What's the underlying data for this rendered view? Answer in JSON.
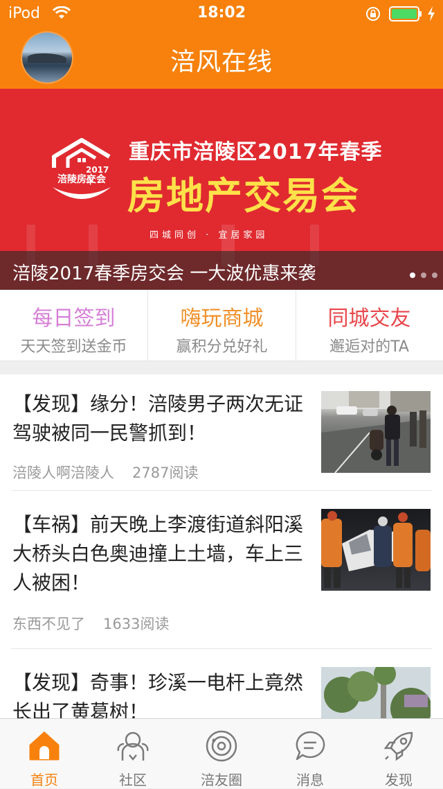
{
  "status_bar": {
    "carrier": "iPod",
    "time": "18:02",
    "battery_color": "#4cd964"
  },
  "nav": {
    "title": "涪风在线"
  },
  "banner": {
    "logo_year": "2017年",
    "logo_name": "涪陵房交会",
    "headline_line1": "重庆市涪陵区2017年春季",
    "headline_line2": "房地产交易会",
    "slogan": "四城同创 · 宜居家园",
    "caption": "涪陵2017春季房交会 一大波优惠来袭",
    "pager": {
      "count": 3,
      "active_index": 0
    },
    "background_color": "#e02a30",
    "headline_accent_color": "#ffe14a"
  },
  "quick_entries": [
    {
      "title": "每日签到",
      "subtitle": "天天签到送金币",
      "color": "#d67fd6"
    },
    {
      "title": "嗨玩商城",
      "subtitle": "赢积分兑好礼",
      "color": "#f0902a"
    },
    {
      "title": "同城交友",
      "subtitle": "邂逅对的TA",
      "color": "#e8464a"
    }
  ],
  "articles": [
    {
      "title": "【发现】缘分！涪陵男子两次无证驾驶被同一民警抓到！",
      "author": "涪陵人啊涪陵人",
      "reads": "2787阅读"
    },
    {
      "title": "【车祸】前天晚上李渡街道斜阳溪大桥头白色奥迪撞上土墙，车上三人被困！",
      "author": "东西不见了",
      "reads": "1633阅读"
    },
    {
      "title": "【发现】奇事！珍溪一电杆上竟然长出了黄葛树！",
      "author": "",
      "reads": ""
    }
  ],
  "tabbar": {
    "active_color": "#f7810c",
    "items": [
      {
        "label": "首页",
        "icon": "home-icon",
        "active": true
      },
      {
        "label": "社区",
        "icon": "community-icon",
        "active": false
      },
      {
        "label": "涪友圈",
        "icon": "moments-icon",
        "active": false
      },
      {
        "label": "消息",
        "icon": "message-icon",
        "active": false
      },
      {
        "label": "发现",
        "icon": "rocket-icon",
        "active": false
      }
    ]
  },
  "theme": {
    "brand_color": "#f7810c"
  }
}
